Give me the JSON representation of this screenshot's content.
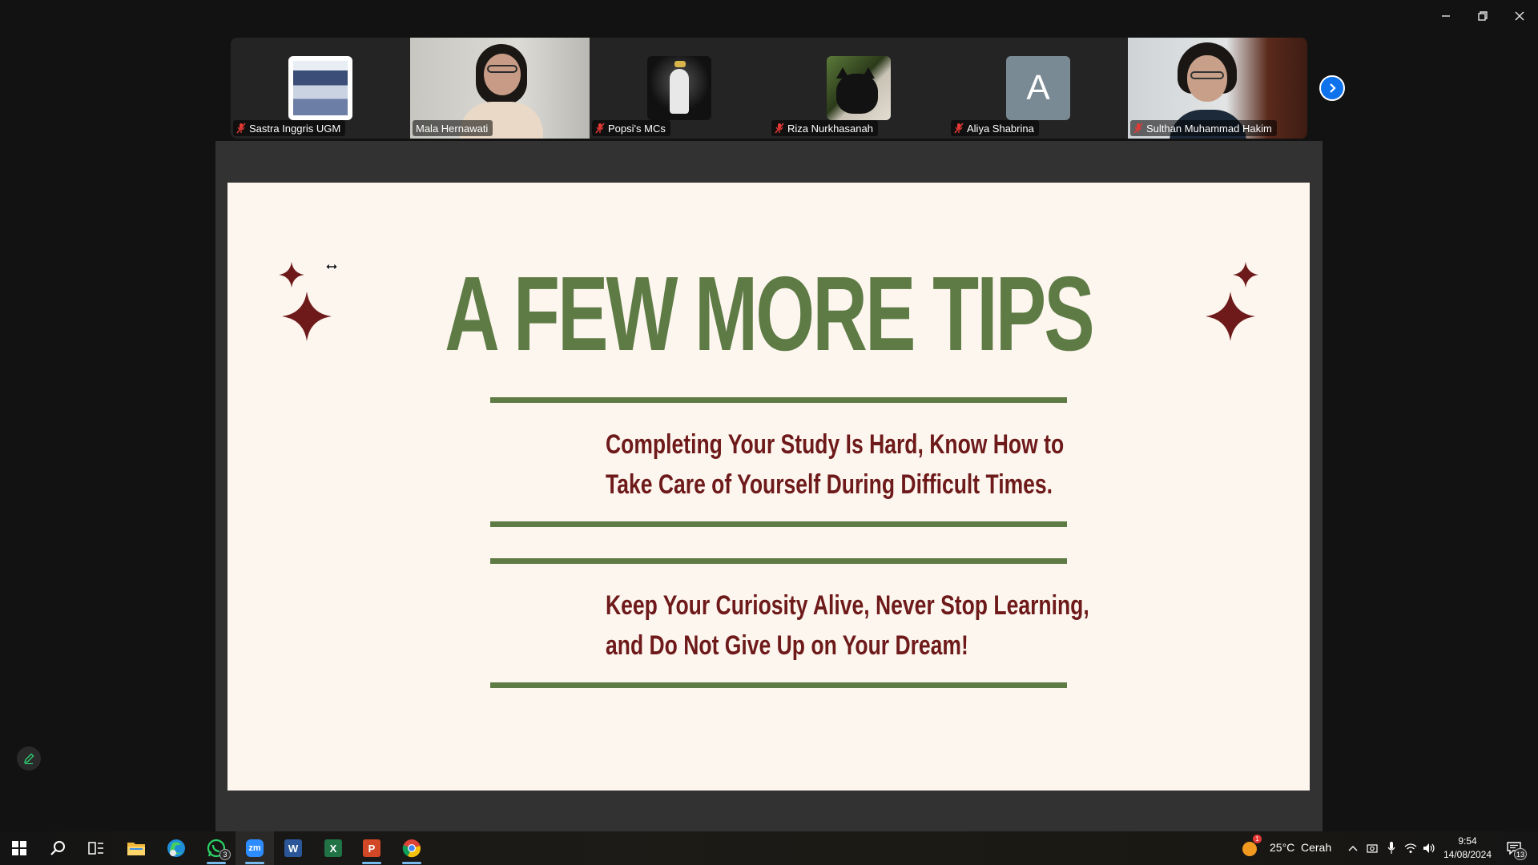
{
  "window": {
    "minimize_label": "Minimize",
    "restore_label": "Restore",
    "close_label": "Close"
  },
  "participants": [
    {
      "name": "Sastra Inggris UGM",
      "muted": true,
      "kind": "photo"
    },
    {
      "name": "Mala Hernawati",
      "muted": false,
      "kind": "video",
      "active_speaker": true
    },
    {
      "name": "Popsi's MCs",
      "muted": true,
      "kind": "logo"
    },
    {
      "name": "Riza Nurkhasanah",
      "muted": true,
      "kind": "cat-photo"
    },
    {
      "name": "Aliya Shabrina",
      "muted": true,
      "kind": "initial",
      "initial": "A"
    },
    {
      "name": "Sulthan Muhammad Hakim",
      "muted": true,
      "kind": "video"
    }
  ],
  "slide": {
    "title": "A FEW MORE TIPS",
    "tips": [
      {
        "line1": "Completing Your Study Is Hard, Know How to",
        "line2": "Take Care of Yourself During Difficult Times."
      },
      {
        "line1": "Keep Your Curiosity Alive, Never Stop Learning,",
        "line2": "and Do Not Give Up on Your Dream!"
      }
    ]
  },
  "taskbar": {
    "apps": [
      "start-icon",
      "search-icon",
      "task-view-icon",
      "file-explorer-icon",
      "edge-icon",
      "whatsapp-icon",
      "zoom-icon",
      "word-icon",
      "excel-icon",
      "powerpoint-icon",
      "chrome-icon"
    ],
    "whatsapp_badge": "3",
    "zoom_label": "zm",
    "word_label": "W",
    "excel_label": "X",
    "powerpoint_label": "P",
    "weather_temp": "25°C",
    "weather_desc": "Cerah",
    "weather_badge": "1",
    "time": "9:54",
    "date": "14/08/2024",
    "notification_count": "13"
  },
  "colors": {
    "title_green": "#5e7b45",
    "tip_maroon": "#6e1a1a",
    "slide_bg": "#fdf6ef",
    "active_speaker": "#27c46a",
    "zoom_blue": "#0e72ed"
  }
}
